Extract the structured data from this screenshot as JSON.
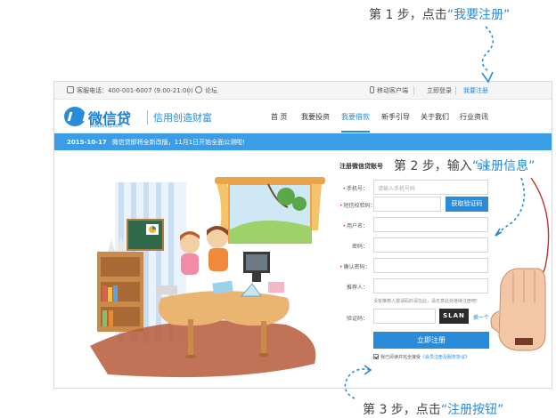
{
  "steps": {
    "step1": {
      "prefix": "第 1 步，点击",
      "highlight": "“我要注册”"
    },
    "step2": {
      "prefix": "第 2 步，输入",
      "highlight": "“注册信息”"
    },
    "step3": {
      "prefix": "第 3 步，点击",
      "highlight": "“注册按钮”"
    }
  },
  "topbar": {
    "hotline": "客服电话：400-001-6007 (9:00-21:00)",
    "forum": "论坛",
    "mobile_client": "移动客户端",
    "login": "立即登录",
    "register": "我要注册"
  },
  "header": {
    "logo_text": "微信贷",
    "logo_domain": "jcbanking.com",
    "slogan": "信用创造财富",
    "nav": [
      "首 页",
      "我要投资",
      "我要借款",
      "新手引导",
      "关于我们",
      "行业资讯"
    ],
    "nav_active_index": 2
  },
  "notice": {
    "date": "2015-10-17",
    "text": "微信贷即将全新改版，11月1日开始全面公测啦!"
  },
  "form": {
    "title": "注册微信贷账号",
    "login_link": "登陆",
    "phone_label": "手机号：",
    "phone_placeholder": "请输入手机号码",
    "sms_label": "短信校验码：",
    "sms_button": "获取验证码",
    "username_label": "用户名：",
    "password_label": "密码：",
    "confirm_label": "确认密码：",
    "referrer_label": "推荐人：",
    "referrer_hint": "没有推荐人邀请码的请在此，请无意此处继续注册吧!",
    "captcha_label": "验证码：",
    "captcha_text": "SLAN",
    "refresh_label": "换一个",
    "submit_label": "立即注册",
    "agree_prefix": "我已阅读并完全接受",
    "agree_link": "《会员注册及服务协议》"
  },
  "colors": {
    "brand_blue": "#2a8bd8",
    "notice_blue": "#3b9de6",
    "required_star": "#e33333"
  }
}
